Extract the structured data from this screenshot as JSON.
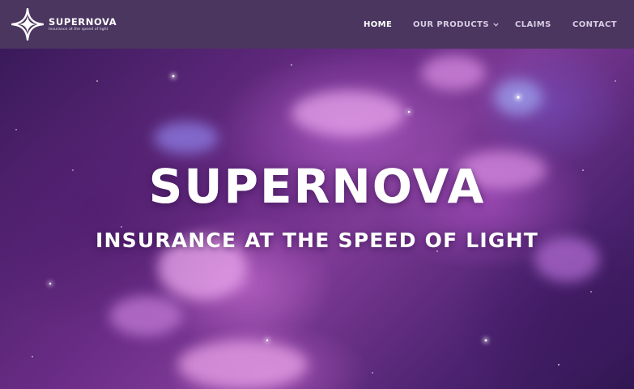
{
  "header": {
    "brand_name": "SUPERNOVA",
    "brand_tagline": "Insurance at the speed of light",
    "brand_icon": "four-point-star-icon",
    "background_color": "#4b3660"
  },
  "nav": {
    "items": [
      {
        "label": "HOME",
        "active": true
      },
      {
        "label": "OUR PRODUCTS",
        "has_dropdown": true,
        "dropdown_icon": "chevron-down-icon"
      },
      {
        "label": "CLAIMS"
      },
      {
        "label": "CONTACT"
      }
    ]
  },
  "hero": {
    "title": "SUPERNOVA",
    "subtitle": "INSURANCE AT THE SPEED OF LIGHT",
    "background": "purple-nebula-starfield"
  }
}
